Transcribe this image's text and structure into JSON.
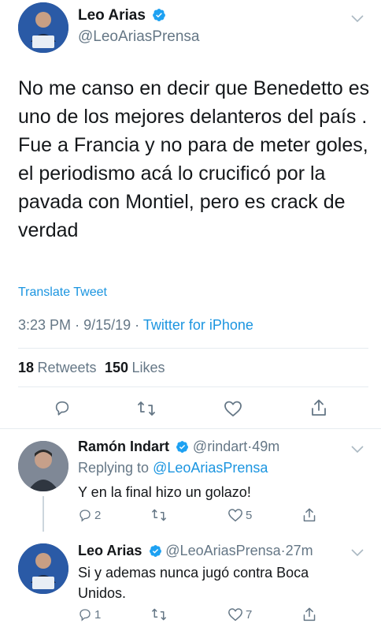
{
  "main_tweet": {
    "author_name": "Leo Arias",
    "author_handle": "@LeoAriasPrensa",
    "text_lines": [
      "No me canso en decir que Benedetto es",
      "uno de los mejores delanteros del país .",
      "Fue a Francia y  no para de meter goles,",
      "el periodismo acá lo crucificó por la",
      "pavada con Montiel, pero es crack de",
      "verdad"
    ],
    "translate_label": "Translate Tweet",
    "time": "3:23 PM",
    "date": "9/15/19",
    "source": "Twitter for iPhone",
    "retweets_count": "18",
    "retweets_label": "Retweets",
    "likes_count": "150",
    "likes_label": "Likes"
  },
  "replies": [
    {
      "author_name": "Ramón Indart",
      "author_handle": "@rindart",
      "age": "49m",
      "replying_prefix": "Replying to",
      "replying_to": "@LeoAriasPrensa",
      "text": "Y en la final hizo un golazo!",
      "reply_count": "2",
      "retweet_count": "",
      "like_count": "5"
    },
    {
      "author_name": "Leo Arias",
      "author_handle": "@LeoAriasPrensa",
      "age": "27m",
      "text_lines": [
        "Si y ademas nunca jugó contra Boca",
        "Unidos."
      ],
      "reply_count": "1",
      "retweet_count": "",
      "like_count": "7"
    }
  ],
  "separator": "·",
  "colors": {
    "accent": "#1b95e0",
    "muted": "#657786",
    "text": "#14171a",
    "divider": "#e6ecf0"
  },
  "icons": [
    "verified-badge-icon",
    "chevron-down-icon",
    "reply-icon",
    "retweet-icon",
    "like-icon",
    "share-icon"
  ]
}
